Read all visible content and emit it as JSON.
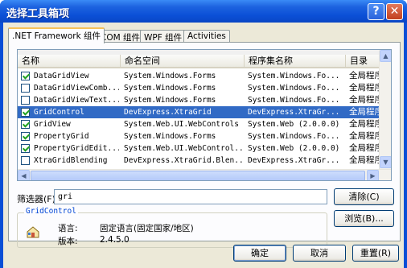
{
  "window": {
    "title": "选择工具箱项"
  },
  "titlebar": {
    "help_glyph": "?",
    "close_glyph": "✕"
  },
  "tabs": [
    {
      "label": ".NET Framework 组件",
      "active": true
    },
    {
      "label": "COM 组件",
      "active": false
    },
    {
      "label": "WPF 组件",
      "active": false
    },
    {
      "label": "Activities",
      "active": false
    }
  ],
  "table": {
    "columns": [
      "名称",
      "命名空间",
      "程序集名称",
      "目录"
    ],
    "rows": [
      {
        "checked": true,
        "name": "DataGridView",
        "namespace": "System.Windows.Forms",
        "assembly": "System.Windows.Fo...",
        "directory": "全局程序",
        "selected": false
      },
      {
        "checked": false,
        "name": "DataGridViewComb...",
        "namespace": "System.Windows.Forms",
        "assembly": "System.Windows.Fo...",
        "directory": "全局程序",
        "selected": false
      },
      {
        "checked": false,
        "name": "DataGridViewText...",
        "namespace": "System.Windows.Forms",
        "assembly": "System.Windows.Fo...",
        "directory": "全局程序",
        "selected": false
      },
      {
        "checked": true,
        "name": "GridControl",
        "namespace": "DevExpress.XtraGrid",
        "assembly": "DevExpress.XtraGr...",
        "directory": "全局程序",
        "selected": true
      },
      {
        "checked": true,
        "name": "GridView",
        "namespace": "System.Web.UI.WebControls",
        "assembly": "System.Web (2.0.0.0)",
        "directory": "全局程序",
        "selected": false
      },
      {
        "checked": true,
        "name": "PropertyGrid",
        "namespace": "System.Windows.Forms",
        "assembly": "System.Windows.Fo...",
        "directory": "全局程序",
        "selected": false
      },
      {
        "checked": true,
        "name": "PropertyGridEdit...",
        "namespace": "System.Web.UI.WebControl...",
        "assembly": "System.Web (2.0.0.0)",
        "directory": "全局程序",
        "selected": false
      },
      {
        "checked": false,
        "name": "XtraGridBlending",
        "namespace": "DevExpress.XtraGrid.Blen...",
        "assembly": "DevExpress.XtraGr...",
        "directory": "全局程序",
        "selected": false
      }
    ]
  },
  "filter": {
    "label": "筛选器(F):",
    "value": "gri",
    "clear_label": "清除(C)"
  },
  "details": {
    "group_title": "GridControl",
    "language_label": "语言:",
    "language_value": "固定语言(固定国家/地区)",
    "version_label": "版本:",
    "version_value": "2.4.5.0",
    "browse_label": "浏览(B)..."
  },
  "footer": {
    "ok_label": "确定",
    "cancel_label": "取消",
    "reset_label": "重置(R)"
  },
  "scroll": {
    "up": "▲",
    "down": "▼"
  },
  "colors": {
    "selection": "#316ac5",
    "titlebar": "#0a4fd6",
    "group_title": "#0046d5"
  }
}
